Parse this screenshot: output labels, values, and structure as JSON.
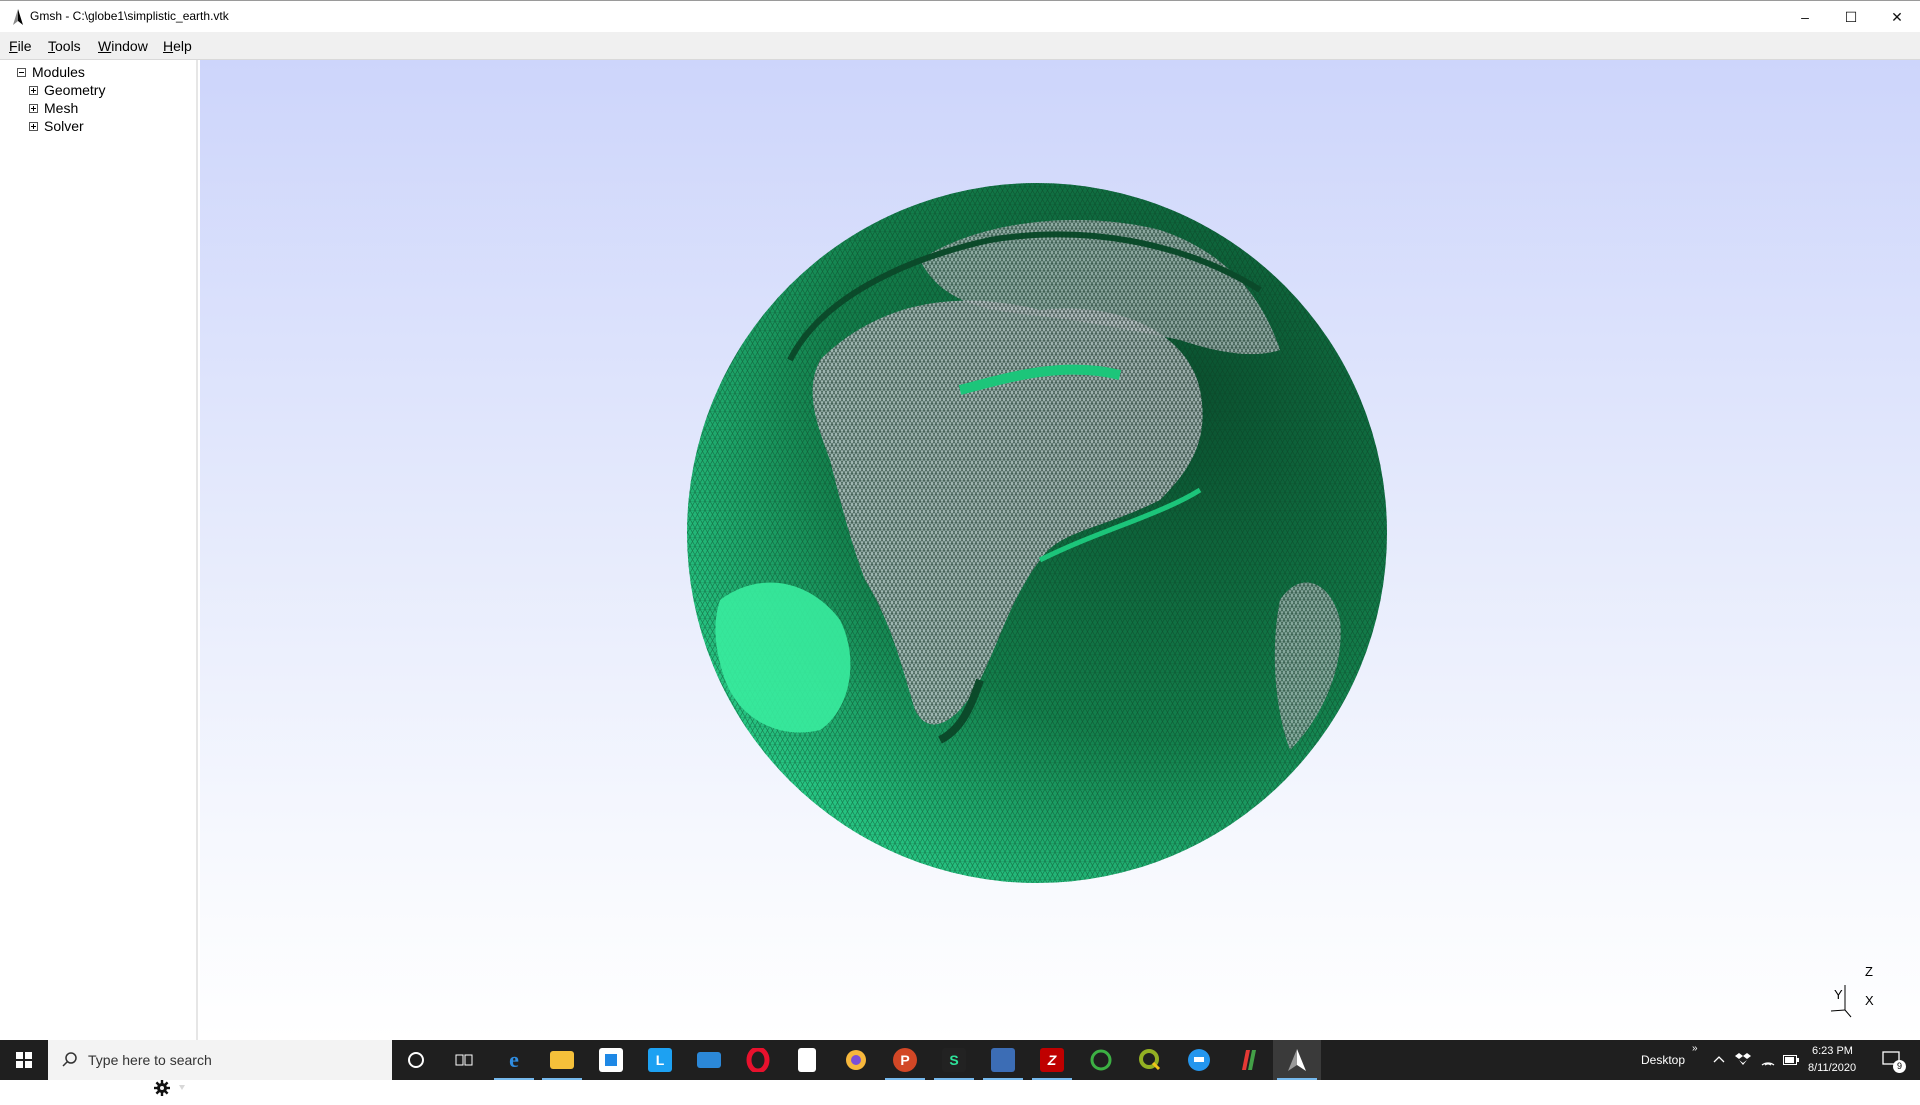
{
  "window": {
    "title": "Gmsh - C:\\globe1\\simplistic_earth.vtk",
    "minimize_glyph": "–",
    "maximize_glyph": "☐",
    "close_glyph": "✕"
  },
  "menu": {
    "file": {
      "accel": "F",
      "rest": "ile"
    },
    "tools": {
      "accel": "T",
      "rest": "ools"
    },
    "window": {
      "accel": "W",
      "rest": "indow"
    },
    "help": {
      "accel": "H",
      "rest": "elp"
    }
  },
  "tree": {
    "root": "Modules",
    "children": [
      "Geometry",
      "Mesh",
      "Solver"
    ]
  },
  "viewport": {
    "axis_z": "Z",
    "axis_y": "Y",
    "axis_x": "X",
    "colors": {
      "bg_top": "#cdd5fb",
      "mesh_dark": "#0d5a34",
      "mesh_light": "#2ee39a"
    }
  },
  "taskbar": {
    "search_placeholder": "Type here to search",
    "desktop_label": "Desktop",
    "time": "6:23 PM",
    "date": "8/11/2020",
    "notification_count": "9",
    "icons": [
      "cortana-icon",
      "task-view-icon",
      "edge-icon",
      "file-explorer-icon",
      "store-icon",
      "l-app-icon",
      "mail-icon",
      "opera-icon",
      "notepad-icon",
      "browser-icon",
      "powerpoint-icon",
      "s-app-icon",
      "network-app-icon",
      "filezilla-icon",
      "circle-app-icon",
      "qgis-icon",
      "docker-icon",
      "paint-app-icon",
      "gmsh-icon"
    ]
  }
}
